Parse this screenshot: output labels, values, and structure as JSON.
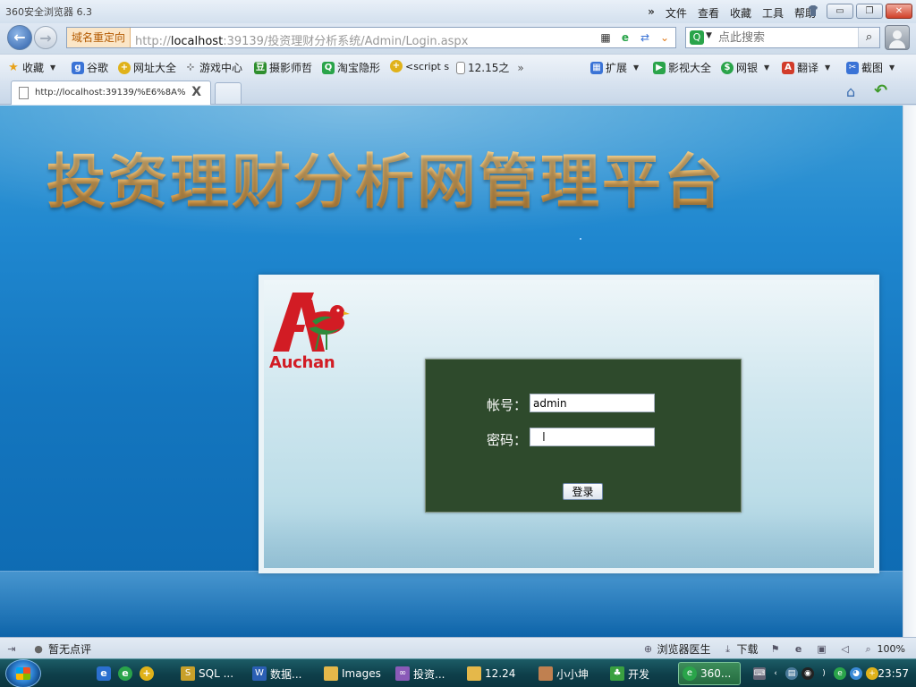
{
  "browser": {
    "title": "360安全浏览器 6.3",
    "menu": [
      "文件",
      "查看",
      "收藏",
      "工具",
      "帮助"
    ],
    "menu_chevron": "»",
    "window_buttons": {
      "minimize": "▭",
      "restore": "❐",
      "close": "✕"
    },
    "address": {
      "redirect_label": "域名重定向",
      "url_prefix": "http://",
      "url_host": "localhost",
      "url_rest": ":39139/投资理财分析系统/Admin/Login.aspx"
    },
    "search": {
      "placeholder": "点此搜索",
      "engine": "Q"
    },
    "bookmarks": [
      {
        "label": "收藏",
        "icon": "star-icon",
        "color": "#e8a21a"
      },
      {
        "label": "谷歌",
        "icon": "google-icon",
        "color": "#3a73d6"
      },
      {
        "label": "网址大全",
        "icon": "plus-circle-icon",
        "color": "#e0b21a"
      },
      {
        "label": "游戏中心",
        "icon": "gamepad-icon",
        "color": "#666666"
      },
      {
        "label": "摄影师哲",
        "icon": "douban-icon",
        "color": "#2f8f2f"
      },
      {
        "label": "淘宝隐形",
        "icon": "search-green-icon",
        "color": "#2aa44a"
      },
      {
        "label": "<script s",
        "icon": "plus-circle-icon",
        "color": "#e0b21a"
      },
      {
        "label": "12.15之",
        "icon": "page-icon",
        "color": "#888888"
      }
    ],
    "bookmarks_more": "»",
    "bookmarks_right": [
      {
        "label": "扩展",
        "icon": "grid-icon",
        "color": "#3a73d6"
      },
      {
        "label": "影视大全",
        "icon": "play-icon",
        "color": "#2aa44a"
      },
      {
        "label": "网银",
        "icon": "bank-icon",
        "color": "#2aa44a"
      },
      {
        "label": "翻译",
        "icon": "translate-icon",
        "color": "#d23c2a"
      },
      {
        "label": "截图",
        "icon": "scissors-icon",
        "color": "#3a73d6"
      }
    ],
    "tab": {
      "title": "http://localhost:39139/%E6%8A%",
      "close": "X"
    }
  },
  "page": {
    "banner_title": "投资理财分析网管理平台",
    "logo_text": "Auchan",
    "login": {
      "account_label": "帐号：",
      "account_value": "admin",
      "password_label": "密码：",
      "password_value": "",
      "submit_label": "登录"
    }
  },
  "statusbar": {
    "comment": "暂无点评",
    "doctor": "浏览器医生",
    "download": "下载",
    "zoom": "100%"
  },
  "taskbar": {
    "items": [
      {
        "label": "SQL ...",
        "icon": "sql-icon",
        "color": "#c8a02a"
      },
      {
        "label": "数据...",
        "icon": "word-icon",
        "color": "#2b5fb4"
      },
      {
        "label": "Images",
        "icon": "folder-icon",
        "color": "#e5b84a"
      },
      {
        "label": "投资...",
        "icon": "vs-icon",
        "color": "#8a5ab8"
      },
      {
        "label": "12.24",
        "icon": "folder-icon",
        "color": "#e5b84a"
      },
      {
        "label": "小小坤",
        "icon": "chat-avatar-icon",
        "color": "#c08050"
      },
      {
        "label": "开发",
        "icon": "tree-icon",
        "color": "#3aa040"
      },
      {
        "label": "360...",
        "icon": "browser-360-icon",
        "color": "#2aa44a"
      }
    ],
    "clock": "23:57"
  }
}
